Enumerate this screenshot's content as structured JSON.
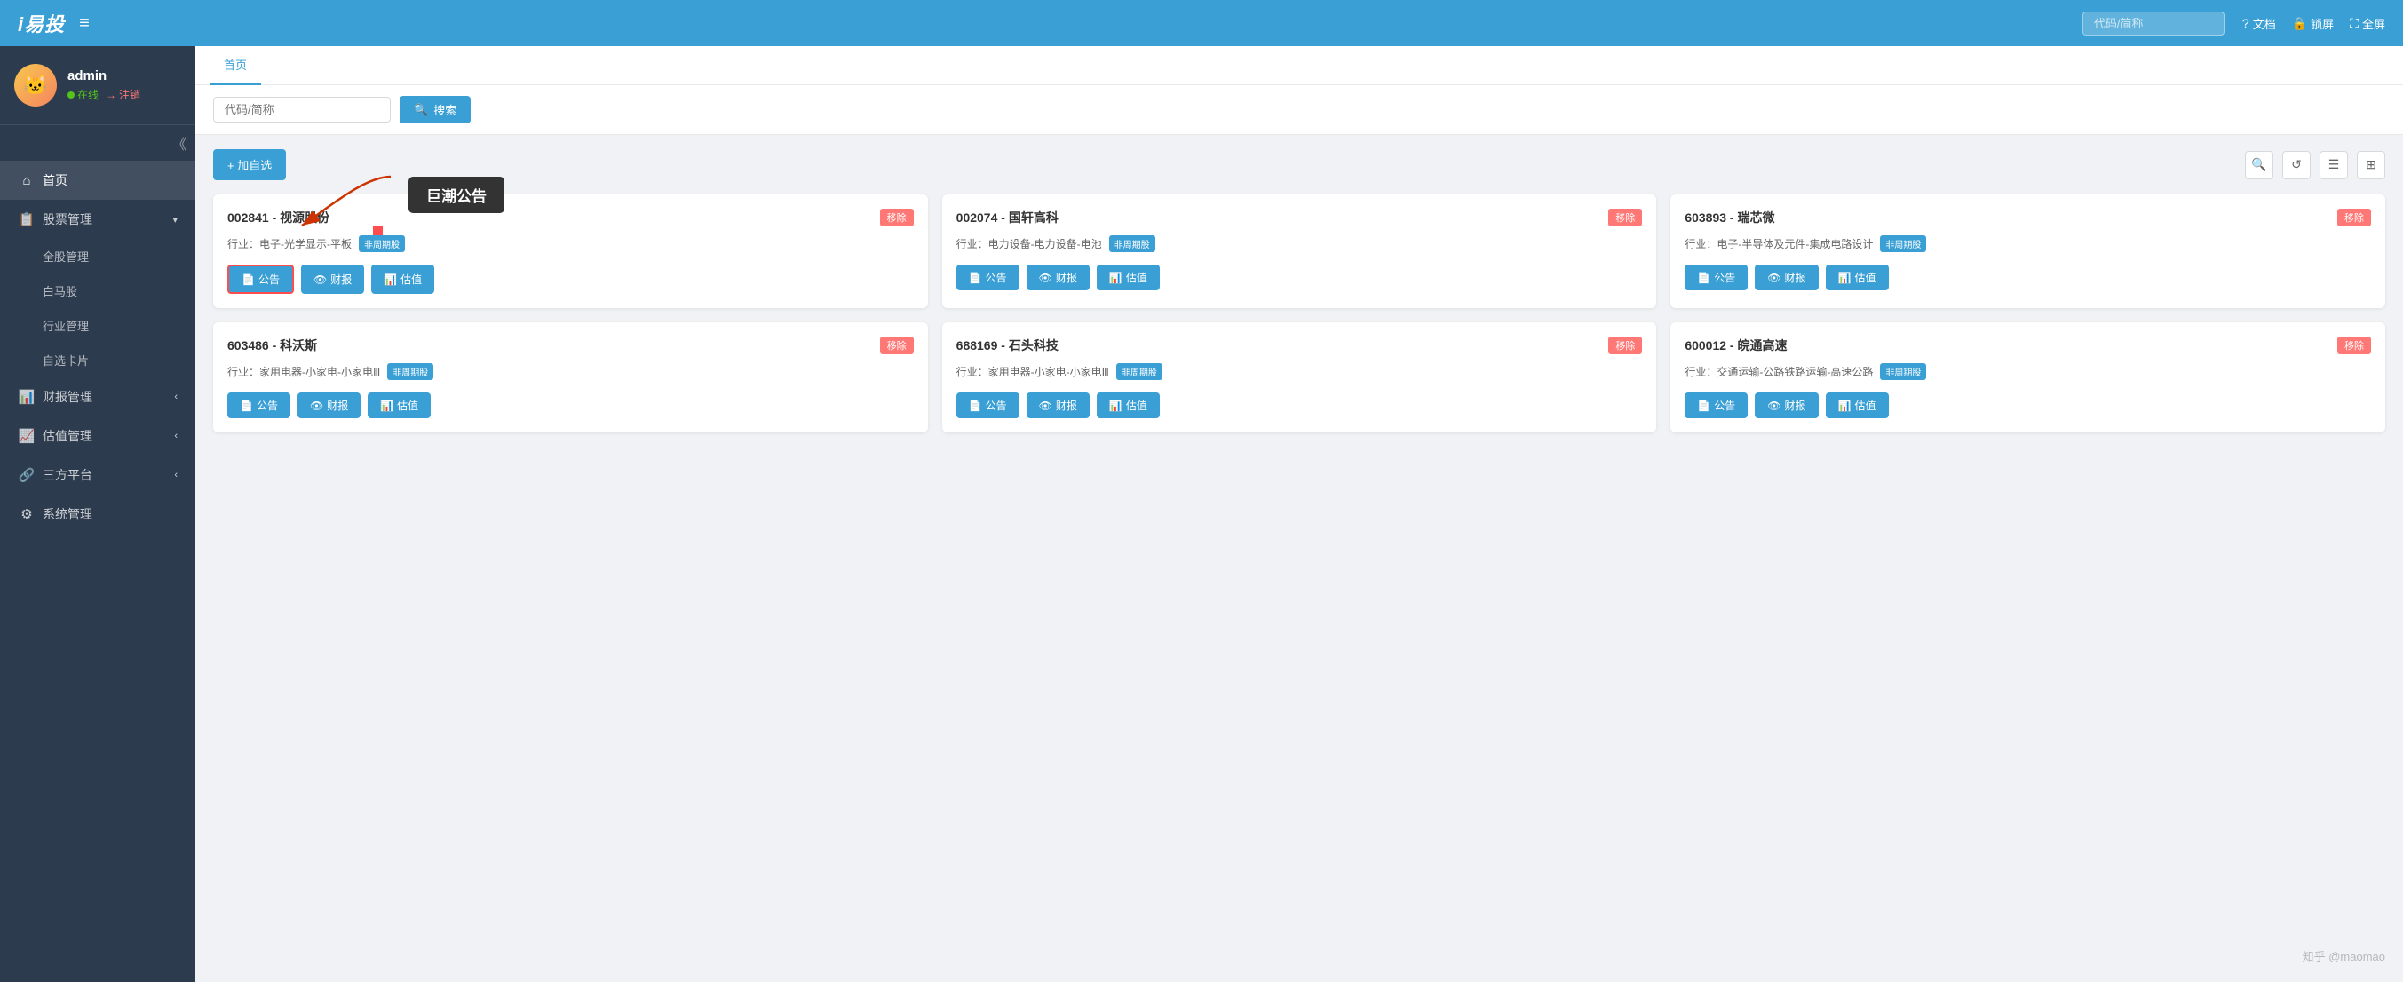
{
  "app": {
    "title": "i易投"
  },
  "header": {
    "hamburger_icon": "≡",
    "search_placeholder": "代码/简称",
    "actions": [
      {
        "icon": "?",
        "label": "文档"
      },
      {
        "icon": "🔒",
        "label": "锁屏"
      },
      {
        "icon": "⛶",
        "label": "全屏"
      }
    ]
  },
  "sidebar": {
    "user": {
      "name": "admin",
      "status_online": "在线",
      "status_logout": "注销",
      "avatar_emoji": "🐱"
    },
    "nav_items": [
      {
        "icon": "⌂",
        "label": "首页",
        "active": true,
        "has_sub": false
      },
      {
        "icon": "📋",
        "label": "股票管理",
        "active": false,
        "has_sub": true
      },
      {
        "icon": "📊",
        "label": "财报管理",
        "active": false,
        "has_sub": true
      },
      {
        "icon": "📈",
        "label": "估值管理",
        "active": false,
        "has_sub": true
      },
      {
        "icon": "🔗",
        "label": "三方平台",
        "active": false,
        "has_sub": true
      },
      {
        "icon": "⚙",
        "label": "系统管理",
        "active": false,
        "has_sub": false
      }
    ],
    "sub_items": [
      "全股管理",
      "白马股",
      "行业管理",
      "自选卡片"
    ]
  },
  "tabs": [
    {
      "label": "首页",
      "active": true
    }
  ],
  "search": {
    "placeholder": "代码/简称",
    "button_label": "搜索",
    "search_icon": "🔍"
  },
  "toolbar": {
    "add_label": "+ 加自选",
    "search_icon": "🔍",
    "refresh_icon": "↺",
    "list_icon": "☰",
    "grid_icon": "⊞"
  },
  "tooltip": {
    "text": "巨潮公告"
  },
  "stocks": [
    {
      "code": "002841",
      "name": "视源股份",
      "industry": "行业：电子-光学显示-平板",
      "tag": "非周期股",
      "actions": [
        "公告",
        "财报",
        "估值"
      ],
      "highlighted_action": 0
    },
    {
      "code": "002074",
      "name": "国轩高科",
      "industry": "行业：电力设备-电力设备-电池",
      "tag": "非周期股",
      "actions": [
        "公告",
        "财报",
        "估值"
      ],
      "highlighted_action": -1
    },
    {
      "code": "603893",
      "name": "瑞芯微",
      "industry": "行业：电子-半导体及元件-集成电路设计",
      "tag": "非周期股",
      "actions": [
        "公告",
        "财报",
        "估值"
      ],
      "highlighted_action": -1
    },
    {
      "code": "603486",
      "name": "科沃斯",
      "industry": "行业：家用电器-小家电-小家电Ⅲ",
      "tag": "非周期股",
      "actions": [
        "公告",
        "财报",
        "估值"
      ],
      "highlighted_action": -1
    },
    {
      "code": "688169",
      "name": "石头科技",
      "industry": "行业：家用电器-小家电-小家电Ⅲ",
      "tag": "非周期股",
      "actions": [
        "公告",
        "财报",
        "估值"
      ],
      "highlighted_action": -1
    },
    {
      "code": "600012",
      "name": "皖通高速",
      "industry": "行业：交通运输-公路铁路运输-高速公路",
      "tag": "非周期股",
      "actions": [
        "公告",
        "财报",
        "估值"
      ],
      "highlighted_action": -1
    }
  ],
  "action_icons": {
    "announcement": "📄",
    "finance": "👁",
    "valuation": "📊"
  },
  "watermark": "知乎 @maomao"
}
